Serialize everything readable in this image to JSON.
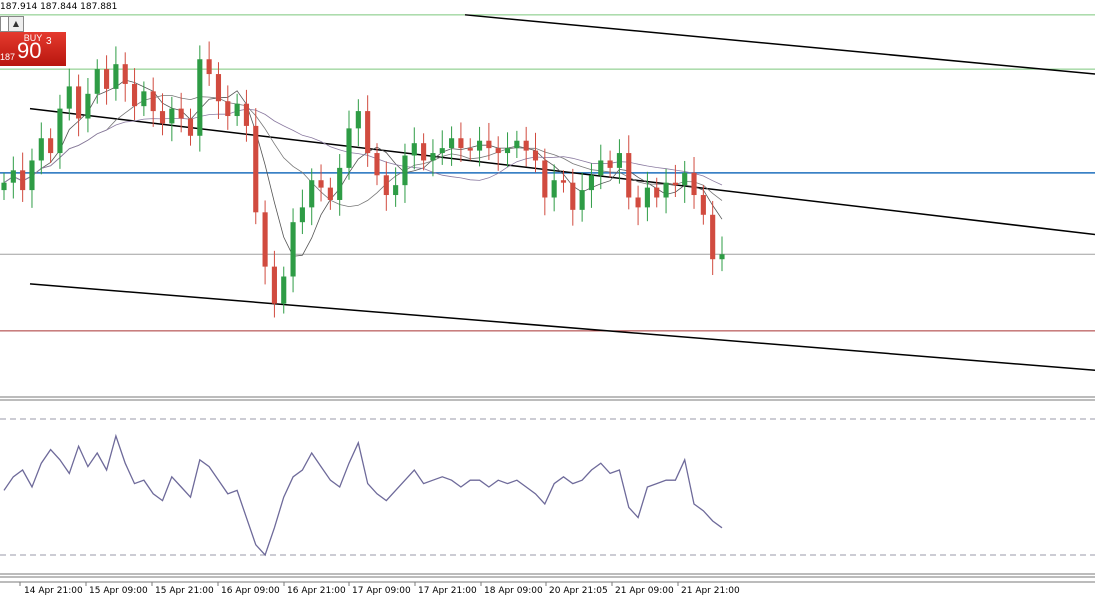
{
  "header": {
    "ohlc_text": "187.914 187.844 187.881"
  },
  "trade_panel": {
    "buy_label": "BUY",
    "price_prefix": "187",
    "price_big": "90",
    "price_super": "3",
    "spin_symbol": "▲"
  },
  "colors": {
    "bull": "#2e9c45",
    "bear": "#d14b3f",
    "trend": "#000000",
    "green_level": "#7cc67c",
    "blue_level": "#1e6fbd",
    "red_level": "#a83232",
    "grey_level": "#a0a0a0",
    "rsi": "#6e6a9a"
  },
  "x_axis_labels": [
    "14 Apr 21:00",
    "15 Apr 09:00",
    "15 Apr 21:00",
    "16 Apr 09:00",
    "16 Apr 21:00",
    "17 Apr 09:00",
    "17 Apr 21:00",
    "18 Apr 09:00",
    "20 Apr 21:05",
    "21 Apr 09:00",
    "21 Apr 21:00"
  ],
  "chart_data": [
    {
      "type": "candlestick",
      "title": "",
      "xlabel": "",
      "ylabel": "",
      "grid": false,
      "series": [
        {
          "name": "",
          "close_values": [
            187.66,
            187.71,
            187.63,
            187.75,
            187.84,
            187.78,
            187.96,
            188.05,
            187.92,
            188.02,
            188.12,
            188.04,
            188.14,
            188.06,
            187.97,
            188.03,
            187.95,
            187.9,
            187.96,
            187.92,
            187.85,
            188.16,
            188.1,
            187.99,
            187.93,
            187.98,
            187.89,
            187.54,
            187.32,
            187.17,
            187.28,
            187.5,
            187.56,
            187.67,
            187.64,
            187.59,
            187.72,
            187.88,
            187.95,
            187.78,
            187.69,
            187.61,
            187.65,
            187.77,
            187.82,
            187.75,
            187.78,
            187.8,
            187.84,
            187.8,
            187.79,
            187.83,
            187.8,
            187.78,
            187.8,
            187.83,
            187.79,
            187.75,
            187.6,
            187.67,
            187.66,
            187.55,
            187.63,
            187.69,
            187.75,
            187.72,
            187.78,
            187.6,
            187.56,
            187.64,
            187.6,
            187.66,
            187.65,
            187.7,
            187.61,
            187.53,
            187.35,
            187.37
          ]
        }
      ],
      "levels": [
        188.34,
        188.12,
        187.7,
        187.37,
        187.06
      ],
      "trend_channel": {
        "upper_line": [
          [
            0,
            188.34
          ],
          [
            1,
            188.1
          ]
        ],
        "middle_line": [
          [
            0,
            187.96
          ],
          [
            1,
            187.45
          ]
        ],
        "lower_line": [
          [
            0,
            187.25
          ],
          [
            1,
            186.9
          ]
        ]
      },
      "x_tick_labels": [
        "14 Apr 21:00",
        "15 Apr 09:00",
        "15 Apr 21:00",
        "16 Apr 09:00",
        "16 Apr 21:00",
        "17 Apr 09:00",
        "17 Apr 21:00",
        "18 Apr 09:00",
        "20 Apr 21:05",
        "21 Apr 09:00",
        "21 Apr 21:00"
      ],
      "ylim": [
        186.8,
        188.4
      ]
    },
    {
      "type": "line",
      "title": "",
      "xlabel": "",
      "ylabel": "",
      "grid": false,
      "series": [
        {
          "name": "",
          "values": [
            49,
            53,
            55,
            50,
            57,
            61,
            58,
            54,
            62,
            56,
            60,
            55,
            65,
            57,
            51,
            52,
            48,
            46,
            53,
            50,
            47,
            58,
            56,
            52,
            48,
            49,
            41,
            33,
            30,
            38,
            47,
            53,
            55,
            60,
            56,
            52,
            50,
            57,
            63,
            51,
            48,
            46,
            49,
            52,
            55,
            51,
            52,
            53,
            52,
            50,
            52,
            52,
            50,
            52,
            51,
            52,
            50,
            48,
            45,
            51,
            53,
            51,
            52,
            55,
            57,
            54,
            55,
            44,
            41,
            50,
            51,
            52,
            52,
            58,
            45,
            43,
            40,
            38
          ]
        }
      ],
      "levels": [
        70,
        30
      ],
      "ylim": [
        25,
        75
      ]
    }
  ]
}
